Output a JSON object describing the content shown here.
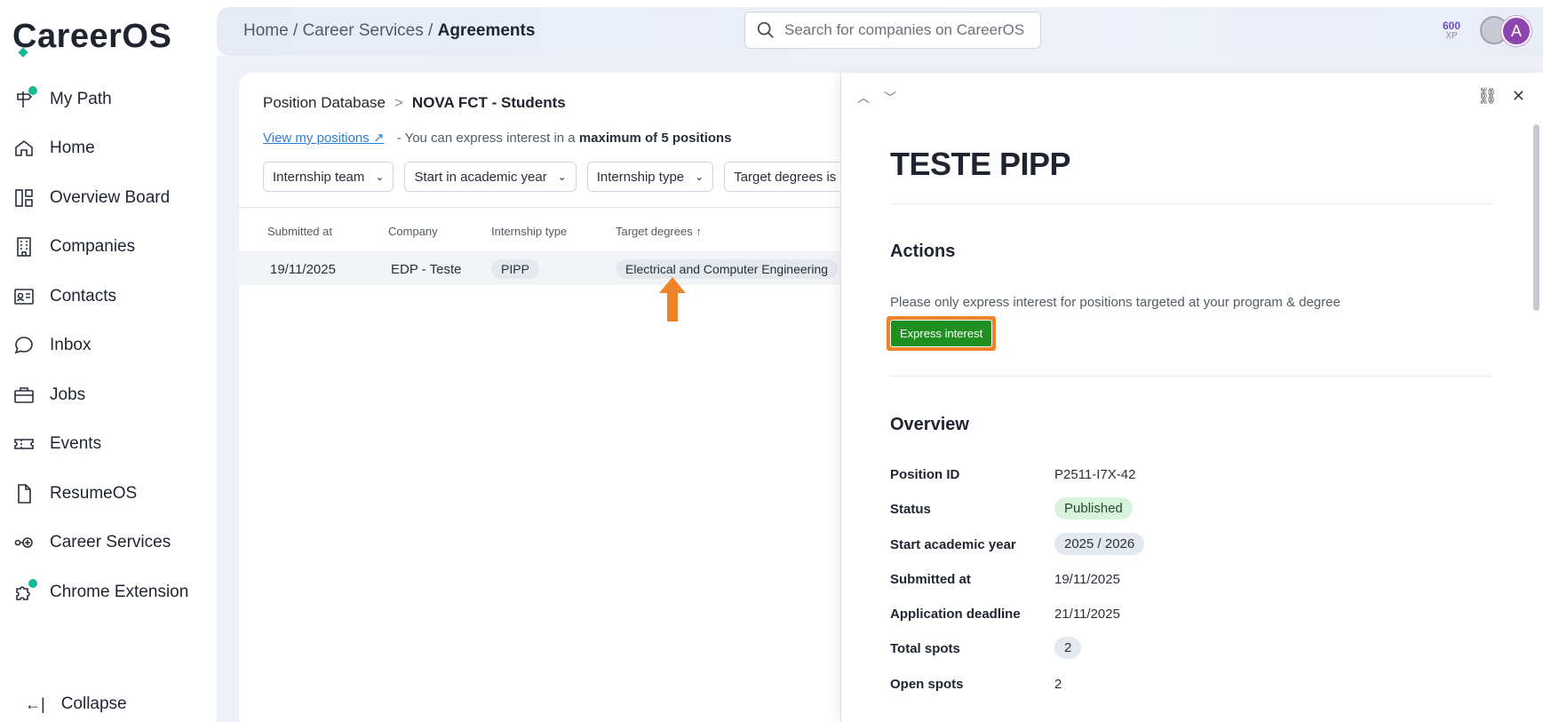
{
  "brand": {
    "name": "CareerOS",
    "accent": "#17b897"
  },
  "sidebar": {
    "items": [
      {
        "label": "My Path",
        "icon": "signpost-icon",
        "badge": true
      },
      {
        "label": "Home",
        "icon": "home-icon",
        "badge": false
      },
      {
        "label": "Overview Board",
        "icon": "board-icon",
        "badge": false
      },
      {
        "label": "Companies",
        "icon": "building-icon",
        "badge": false
      },
      {
        "label": "Contacts",
        "icon": "contact-card-icon",
        "badge": false
      },
      {
        "label": "Inbox",
        "icon": "chat-bubble-icon",
        "badge": false
      },
      {
        "label": "Jobs",
        "icon": "briefcase-icon",
        "badge": false
      },
      {
        "label": "Events",
        "icon": "ticket-icon",
        "badge": false
      },
      {
        "label": "ResumeOS",
        "icon": "document-icon",
        "badge": false
      },
      {
        "label": "Career Services",
        "icon": "career-services-icon",
        "badge": false
      },
      {
        "label": "Chrome Extension",
        "icon": "puzzle-icon",
        "badge": true
      }
    ],
    "collapse_label": "Collapse"
  },
  "header": {
    "breadcrumb": {
      "home": "Home",
      "section": "Career Services",
      "current": "Agreements",
      "sep": " / "
    },
    "search_placeholder": "Search for companies on CareerOS",
    "xp_value": "600",
    "xp_label": "XP",
    "avatar_letter": "A"
  },
  "positions": {
    "breadcrumb": {
      "root": "Position Database",
      "sep": ">",
      "current": "NOVA FCT - Students"
    },
    "view_link": "View my positions ↗",
    "info_prefix": "- You can express interest in a",
    "info_bold": "maximum of 5 positions",
    "filters": [
      "Internship team",
      "Start in academic year",
      "Internship type",
      "Target degrees is"
    ],
    "columns": [
      "Submitted at",
      "Company",
      "Internship type",
      "Target degrees ↑"
    ],
    "rows": [
      {
        "submitted": "19/11/2025",
        "company": "EDP - Teste",
        "type": "PIPP",
        "degrees": "Electrical and Computer Engineering"
      }
    ]
  },
  "drawer": {
    "title": "TESTE PIPP",
    "actions_heading": "Actions",
    "actions_note": "Please only express interest for positions targeted at your program & degree",
    "express_button": "Express interest",
    "overview_heading": "Overview",
    "fields": {
      "position_id": {
        "label": "Position ID",
        "value": "P2511-I7X-42"
      },
      "status": {
        "label": "Status",
        "value": "Published"
      },
      "start_year": {
        "label": "Start academic year",
        "value": "2025 / 2026"
      },
      "submitted": {
        "label": "Submitted at",
        "value": "19/11/2025"
      },
      "deadline": {
        "label": "Application deadline",
        "value": "21/11/2025"
      },
      "total_spots": {
        "label": "Total spots",
        "value": "2"
      },
      "open_spots": {
        "label": "Open spots",
        "value": "2"
      }
    }
  },
  "colors": {
    "express_button": "#1f8f1f",
    "highlight": "#f08229",
    "status_bg": "#d9f3dd",
    "link": "#2f7fd6"
  }
}
